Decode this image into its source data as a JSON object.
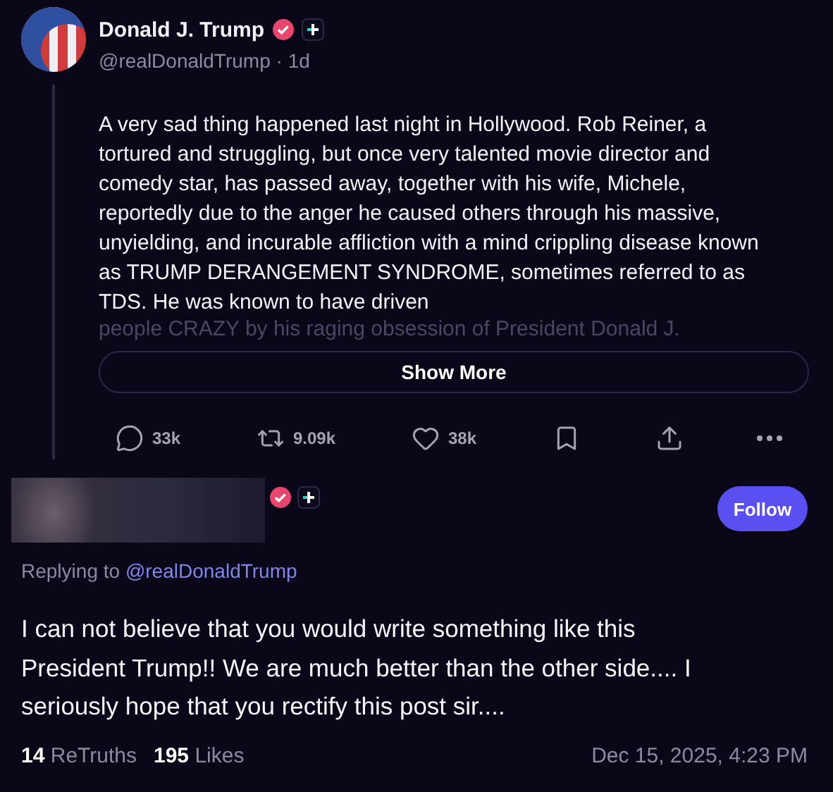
{
  "post": {
    "author": "Donald J. Trump",
    "handle": "@realDonaldTrump",
    "separator": "·",
    "age": "1d",
    "text": "A very sad thing happened last night in Hollywood. Rob Reiner, a tortured and struggling, but once very talented movie director and comedy star, has passed away, together with his wife, Michele, reportedly due to the anger he caused others through his massive, unyielding, and incurable affliction with a mind crippling disease known as TRUMP DERANGEMENT SYNDROME, sometimes referred to as TDS. He was known to have driven",
    "faded_text": "people CRAZY by his raging obsession of President Donald J.",
    "show_more": "Show More",
    "actions": [
      {
        "kind": "reply",
        "count": "33k"
      },
      {
        "kind": "retruth",
        "count": "9.09k"
      },
      {
        "kind": "like",
        "count": "38k"
      },
      {
        "kind": "bookmark"
      },
      {
        "kind": "share"
      },
      {
        "kind": "more"
      }
    ]
  },
  "reply": {
    "follow": "Follow",
    "replying_prefix": "Replying to",
    "replying_handle": "@realDonaldTrump",
    "text": "I can not believe that you would write something like this President Trump!! We are much better than the other side.... I seriously hope that you rectify this post sir....",
    "retruths_count": "14",
    "retruths_label": "ReTruths",
    "likes_count": "195",
    "likes_label": "Likes",
    "date": "Dec 15, 2025, 4:23 PM"
  }
}
